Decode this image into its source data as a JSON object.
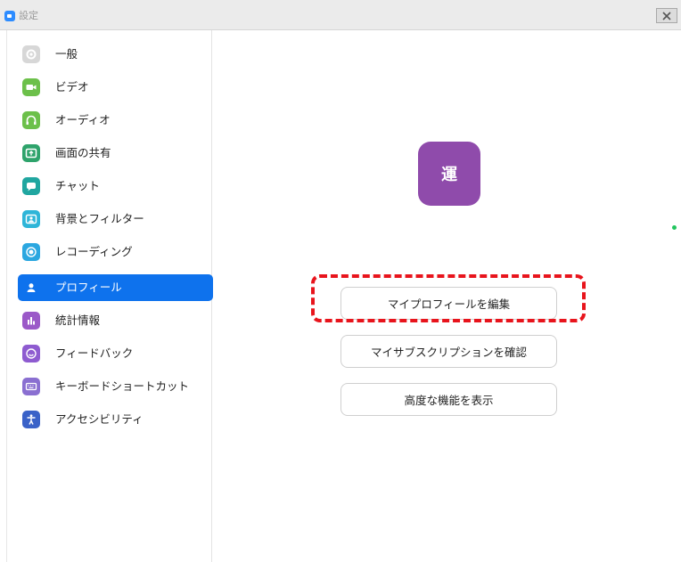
{
  "window": {
    "title": "設定",
    "close_icon": "close-x-icon"
  },
  "sidebar": {
    "items": [
      {
        "label": "一般",
        "icon": "gear-icon",
        "color": "#d7d7d7",
        "active": false
      },
      {
        "label": "ビデオ",
        "icon": "video-camera-icon",
        "color": "#6cc04a",
        "active": false
      },
      {
        "label": "オーディオ",
        "icon": "headphones-icon",
        "color": "#6cc04a",
        "active": false
      },
      {
        "label": "画面の共有",
        "icon": "share-screen-icon",
        "color": "#2ea36b",
        "active": false
      },
      {
        "label": "チャット",
        "icon": "chat-bubble-icon",
        "color": "#20a6a0",
        "active": false
      },
      {
        "label": "背景とフィルター",
        "icon": "background-portrait-icon",
        "color": "#2eb5d8",
        "active": false
      },
      {
        "label": "レコーディング",
        "icon": "record-icon",
        "color": "#2ba7e0",
        "active": false
      },
      {
        "label": "プロフィール",
        "icon": "person-icon",
        "color": "#0e72ed",
        "active": true
      },
      {
        "label": "統計情報",
        "icon": "bar-chart-icon",
        "color": "#9b59c8",
        "active": false
      },
      {
        "label": "フィードバック",
        "icon": "smiley-icon",
        "color": "#8e5bd0",
        "active": false
      },
      {
        "label": "キーボードショートカット",
        "icon": "keyboard-icon",
        "color": "#8a6fd1",
        "active": false
      },
      {
        "label": "アクセシビリティ",
        "icon": "accessibility-icon",
        "color": "#3a62c8",
        "active": false
      }
    ]
  },
  "profile": {
    "avatar_text": "運",
    "avatar_color": "#8f4bab",
    "status_color": "#22c55e",
    "edit_profile_label": "マイプロフィールを編集",
    "subscription_label": "マイサブスクリプションを確認",
    "advanced_label": "高度な機能を表示"
  },
  "annotation": {
    "highlight_color": "#e8141c"
  }
}
